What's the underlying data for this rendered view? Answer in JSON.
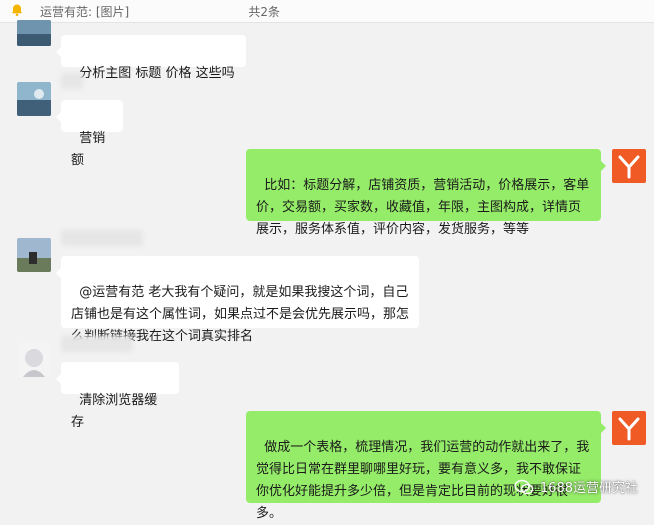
{
  "topbar": {
    "quote_text": "运营有范: [图片]",
    "count_text": "共2条"
  },
  "messages": [
    {
      "side": "left",
      "text": "分析主图 标题 价格 这些吗"
    },
    {
      "side": "left",
      "text": "营销额"
    },
    {
      "side": "right",
      "text": "比如：标题分解，店铺资质，营销活动，价格展示，客单价，交易额，买家数，收藏值，年限，主图构成，详情页展示，服务体系值，评价内容，发货服务，等等"
    },
    {
      "side": "left",
      "text": "@运营有范 老大我有个疑问，就是如果我搜这个词，自己店铺也是有这个属性词，如果点过不是会优先展示吗，那怎么判断链接我在这个词真实排名"
    },
    {
      "side": "left",
      "text": "清除浏览器缓存"
    },
    {
      "side": "right",
      "text": "做成一个表格，梳理情况，我们运营的动作就出来了，我觉得比日常在群里聊哪里好玩，要有意义多，我不敢保证你优化好能提升多少倍，但是肯定比目前的现状要好很多。"
    }
  ],
  "watermark": {
    "text": "1688运营研究社"
  },
  "colors": {
    "right_bubble": "#95ec69",
    "left_bubble": "#ffffff",
    "self_avatar": "#f05a24",
    "background": "#f2f2f2"
  }
}
